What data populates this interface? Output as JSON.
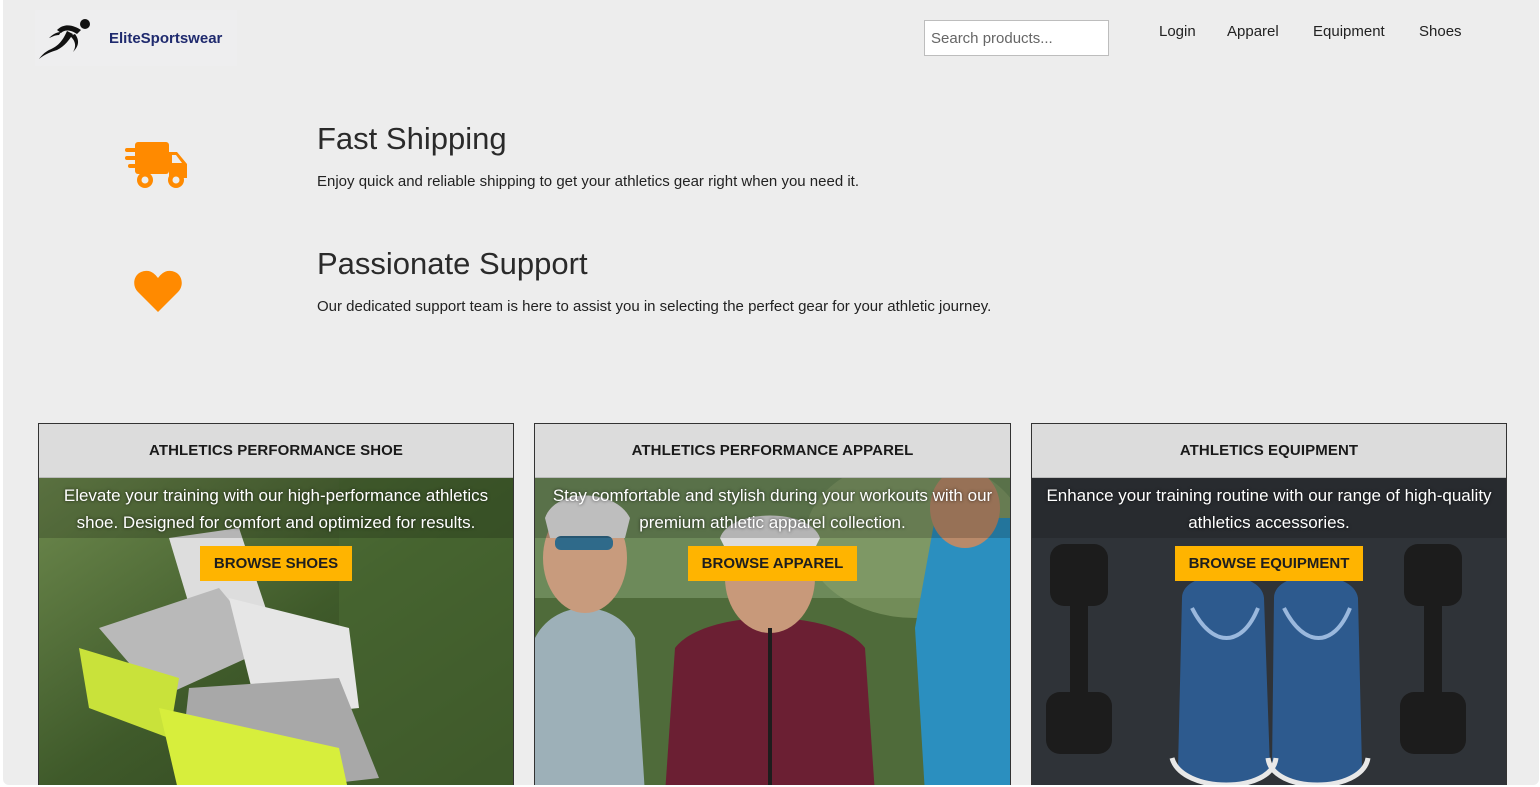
{
  "header": {
    "brand": "EliteSportswear",
    "search_placeholder": "Search products...",
    "nav": [
      "Login",
      "Apparel",
      "Equipment",
      "Shoes"
    ]
  },
  "features": [
    {
      "icon": "truck-icon",
      "title": "Fast Shipping",
      "text": "Enjoy quick and reliable shipping to get your athletics gear right when you need it."
    },
    {
      "icon": "heart-icon",
      "title": "Passionate Support",
      "text": "Our dedicated support team is here to assist you in selecting the perfect gear for your athletic journey."
    }
  ],
  "cards": [
    {
      "title": "ATHLETICS PERFORMANCE SHOE",
      "description": "Elevate your training with our high-performance athletics shoe. Designed for comfort and optimized for results.",
      "button": "BROWSE SHOES"
    },
    {
      "title": "ATHLETICS PERFORMANCE APPAREL",
      "description": "Stay comfortable and stylish during your workouts with our premium athletic apparel collection.",
      "button": "BROWSE APPAREL"
    },
    {
      "title": "ATHLETICS EQUIPMENT",
      "description": "Enhance your training routine with our range of high-quality athletics accessories.",
      "button": "BROWSE EQUIPMENT"
    }
  ],
  "colors": {
    "accent": "#ff8a00",
    "button": "#ffb400",
    "brand_text": "#1f2a6e",
    "background": "#ededed"
  }
}
